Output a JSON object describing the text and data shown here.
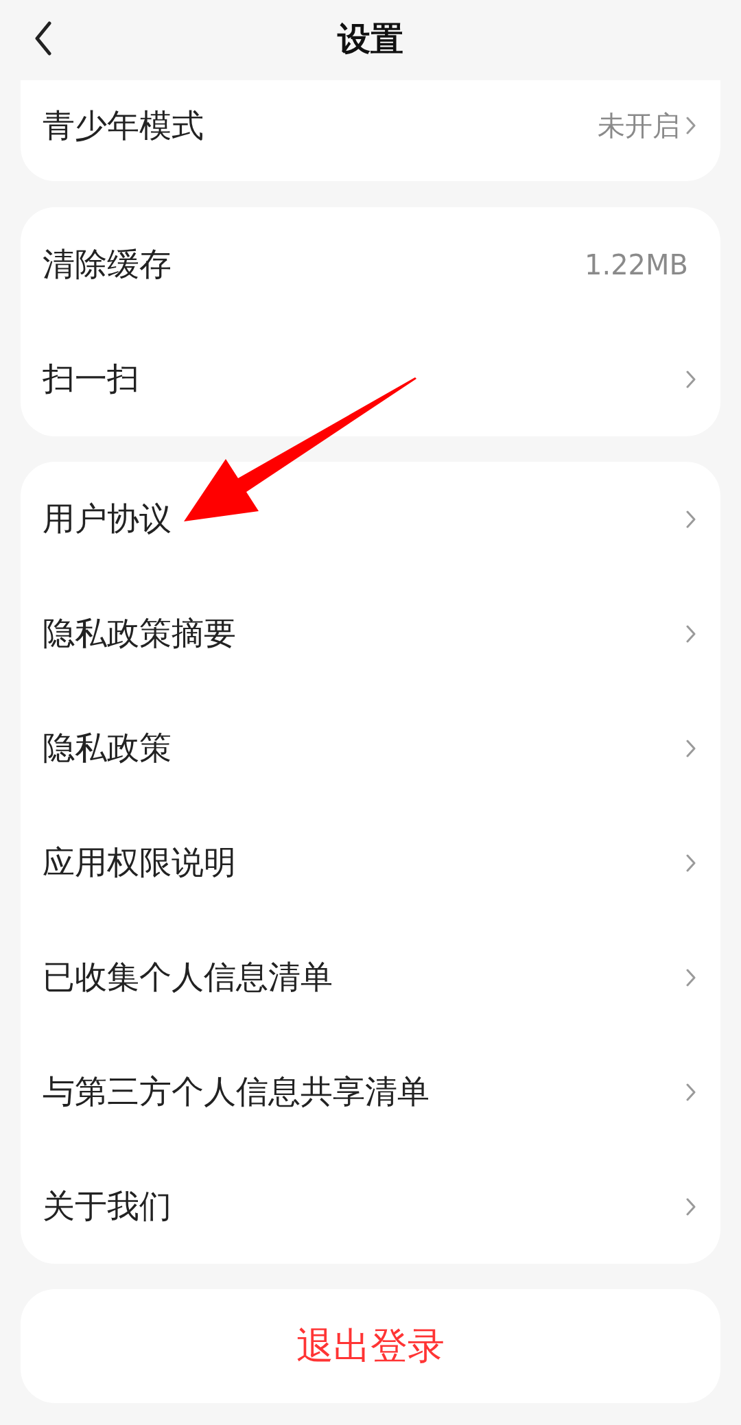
{
  "header": {
    "title": "设置"
  },
  "sections": [
    {
      "rows": [
        {
          "label": "青少年模式",
          "value": "未开启",
          "chevron": true
        }
      ]
    },
    {
      "rows": [
        {
          "label": "清除缓存",
          "value": "1.22MB",
          "chevron": false
        },
        {
          "label": "扫一扫",
          "chevron": true
        }
      ]
    },
    {
      "rows": [
        {
          "label": "用户协议",
          "chevron": true
        },
        {
          "label": "隐私政策摘要",
          "chevron": true
        },
        {
          "label": "隐私政策",
          "chevron": true
        },
        {
          "label": "应用权限说明",
          "chevron": true
        },
        {
          "label": "已收集个人信息清单",
          "chevron": true
        },
        {
          "label": "与第三方个人信息共享清单",
          "chevron": true
        },
        {
          "label": "关于我们",
          "chevron": true
        }
      ]
    }
  ],
  "logout_button": {
    "label": "退出登录"
  },
  "annotations": [
    {
      "kind": "arrow"
    }
  ]
}
